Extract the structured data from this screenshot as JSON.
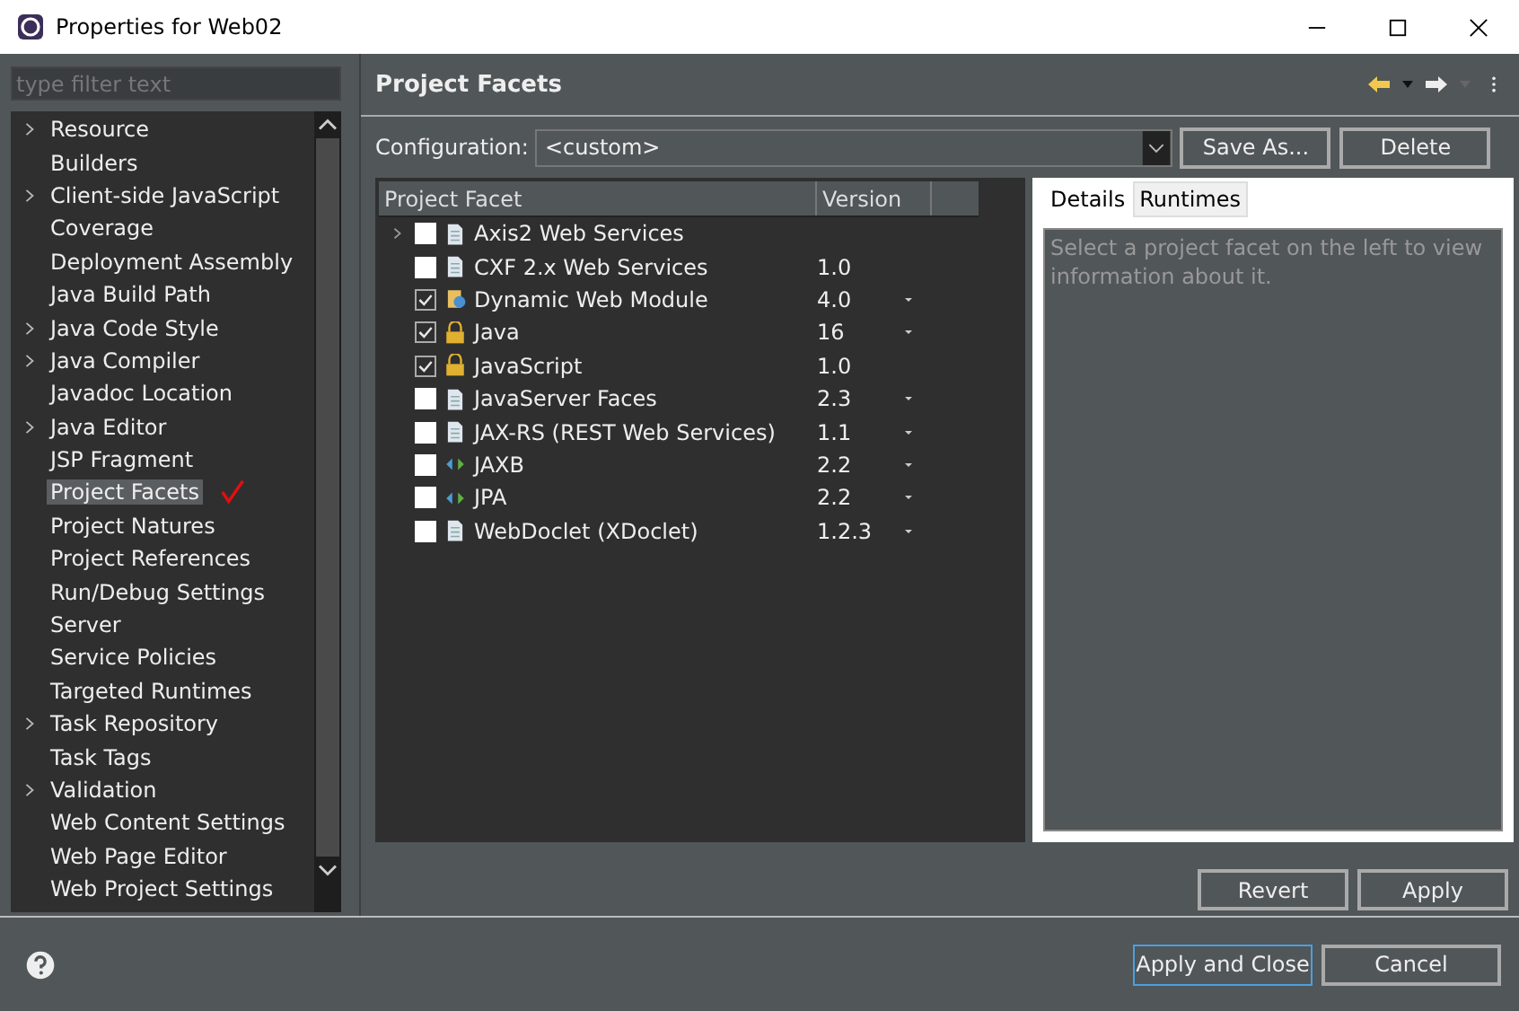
{
  "window": {
    "title": "Properties for Web02"
  },
  "filter": {
    "placeholder": "type filter text"
  },
  "sidebar": {
    "items": [
      {
        "label": "Resource",
        "expandable": true,
        "selected": false
      },
      {
        "label": "Builders",
        "expandable": false,
        "selected": false
      },
      {
        "label": "Client-side JavaScript",
        "expandable": true,
        "selected": false
      },
      {
        "label": "Coverage",
        "expandable": false,
        "selected": false
      },
      {
        "label": "Deployment Assembly",
        "expandable": false,
        "selected": false
      },
      {
        "label": "Java Build Path",
        "expandable": false,
        "selected": false
      },
      {
        "label": "Java Code Style",
        "expandable": true,
        "selected": false
      },
      {
        "label": "Java Compiler",
        "expandable": true,
        "selected": false
      },
      {
        "label": "Javadoc Location",
        "expandable": false,
        "selected": false
      },
      {
        "label": "Java Editor",
        "expandable": true,
        "selected": false
      },
      {
        "label": "JSP Fragment",
        "expandable": false,
        "selected": false
      },
      {
        "label": "Project Facets",
        "expandable": false,
        "selected": true
      },
      {
        "label": "Project Natures",
        "expandable": false,
        "selected": false
      },
      {
        "label": "Project References",
        "expandable": false,
        "selected": false
      },
      {
        "label": "Run/Debug Settings",
        "expandable": false,
        "selected": false
      },
      {
        "label": "Server",
        "expandable": false,
        "selected": false
      },
      {
        "label": "Service Policies",
        "expandable": false,
        "selected": false
      },
      {
        "label": "Targeted Runtimes",
        "expandable": false,
        "selected": false
      },
      {
        "label": "Task Repository",
        "expandable": true,
        "selected": false
      },
      {
        "label": "Task Tags",
        "expandable": false,
        "selected": false
      },
      {
        "label": "Validation",
        "expandable": true,
        "selected": false
      },
      {
        "label": "Web Content Settings",
        "expandable": false,
        "selected": false
      },
      {
        "label": "Web Page Editor",
        "expandable": false,
        "selected": false
      },
      {
        "label": "Web Project Settings",
        "expandable": false,
        "selected": false
      }
    ]
  },
  "page": {
    "title": "Project Facets",
    "configuration": {
      "label": "Configuration:",
      "value": "<custom>"
    },
    "config_buttons": [
      "Save As...",
      "Delete"
    ],
    "table": {
      "columns": [
        "Project Facet",
        "Version"
      ],
      "rows": [
        {
          "name": "Axis2 Web Services",
          "version": "",
          "checked": false,
          "expandable": true,
          "kind": "doc",
          "has_dropdown": false
        },
        {
          "name": "CXF 2.x Web Services",
          "version": "1.0",
          "checked": false,
          "expandable": false,
          "kind": "doc",
          "has_dropdown": false
        },
        {
          "name": "Dynamic Web Module",
          "version": "4.0",
          "checked": true,
          "expandable": false,
          "kind": "web",
          "has_dropdown": true
        },
        {
          "name": "Java",
          "version": "16",
          "checked": true,
          "expandable": false,
          "kind": "lock",
          "has_dropdown": true
        },
        {
          "name": "JavaScript",
          "version": "1.0",
          "checked": true,
          "expandable": false,
          "kind": "lock",
          "has_dropdown": false
        },
        {
          "name": "JavaServer Faces",
          "version": "2.3",
          "checked": false,
          "expandable": false,
          "kind": "doc",
          "has_dropdown": true
        },
        {
          "name": "JAX-RS (REST Web Services)",
          "version": "1.1",
          "checked": false,
          "expandable": false,
          "kind": "doc",
          "has_dropdown": true
        },
        {
          "name": "JAXB",
          "version": "2.2",
          "checked": false,
          "expandable": false,
          "kind": "arrows",
          "has_dropdown": true
        },
        {
          "name": "JPA",
          "version": "2.2",
          "checked": false,
          "expandable": false,
          "kind": "arrows",
          "has_dropdown": true
        },
        {
          "name": "WebDoclet (XDoclet)",
          "version": "1.2.3",
          "checked": false,
          "expandable": false,
          "kind": "doc",
          "has_dropdown": true
        }
      ]
    },
    "detail_tabs": [
      {
        "label": "Details",
        "selected": true
      },
      {
        "label": "Runtimes",
        "selected": false
      }
    ],
    "details_text": "Select a project facet on the left to view information about it.",
    "page_buttons": [
      "Revert",
      "Apply"
    ]
  },
  "dialog_buttons": [
    {
      "label": "Apply and Close",
      "default": true
    },
    {
      "label": "Cancel",
      "default": false
    }
  ]
}
